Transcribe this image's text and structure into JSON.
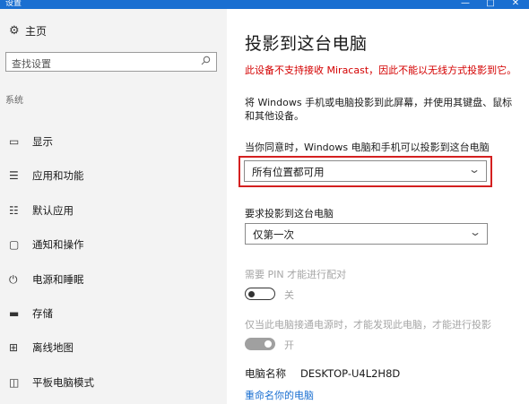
{
  "window": {
    "title": "设置",
    "controls": [
      "—",
      "□",
      "✕"
    ]
  },
  "sidebar": {
    "home_label": "主页",
    "search_placeholder": "查找设置",
    "section_label": "系统",
    "items": [
      {
        "label": "显示",
        "icon": "display-icon"
      },
      {
        "label": "应用和功能",
        "icon": "apps-list-icon"
      },
      {
        "label": "默认应用",
        "icon": "default-apps-icon"
      },
      {
        "label": "通知和操作",
        "icon": "notification-icon"
      },
      {
        "label": "电源和睡眠",
        "icon": "power-icon"
      },
      {
        "label": "存储",
        "icon": "storage-icon"
      },
      {
        "label": "离线地图",
        "icon": "map-icon"
      },
      {
        "label": "平板电脑模式",
        "icon": "tablet-mode-icon"
      }
    ]
  },
  "main": {
    "title": "投影到这台电脑",
    "warning": "此设备不支持接收 Miracast，因此不能以无线方式投影到它。",
    "description": "将 Windows 手机或电脑投影到此屏幕，并使用其键盘、鼠标和其他设备。",
    "availability_label": "当你同意时，Windows 电脑和手机可以投影到这台电脑",
    "availability_value": "所有位置都可用",
    "ask_label": "要求投影到这台电脑",
    "ask_value": "仅第一次",
    "pin_label": "需要 PIN 才能进行配对",
    "pin_state": "关",
    "power_label": "仅当此电脑接通电源时，才能发现此电脑，才能进行投影",
    "power_state": "开",
    "pc_name_label": "电脑名称",
    "pc_name_value": "DESKTOP-U4L2H8D",
    "rename_link": "重命名你的电脑"
  },
  "colors": {
    "accent": "#1a6fd1",
    "warning": "#d40000",
    "highlight_box": "#d42020",
    "sidebar_bg": "#f3f3f3"
  }
}
